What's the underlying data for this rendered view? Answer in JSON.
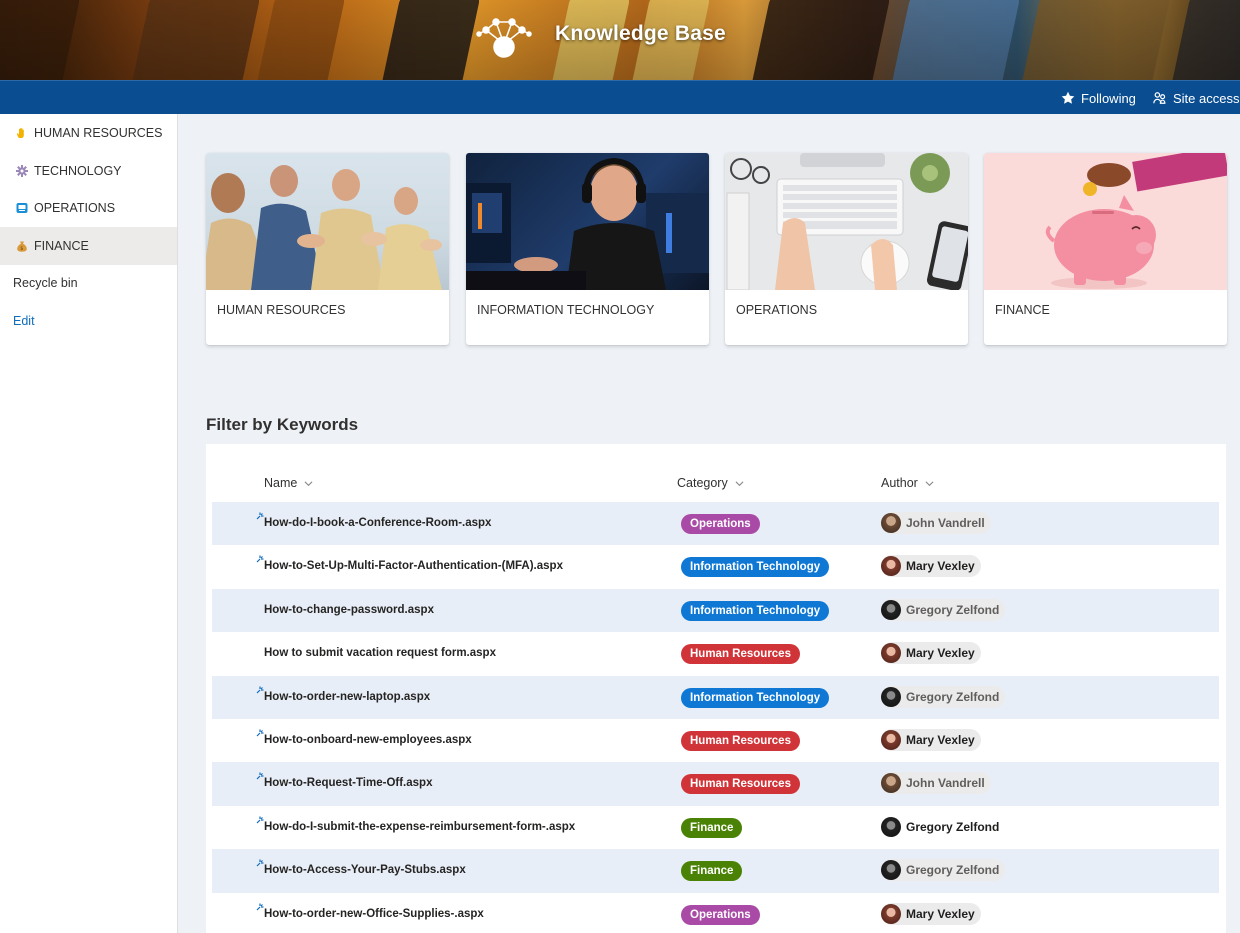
{
  "site": {
    "title": "Knowledge Base"
  },
  "command_bar": {
    "following": "Following",
    "site_access": "Site access"
  },
  "left_nav": {
    "items": [
      {
        "label": "HUMAN RESOURCES",
        "icon": "hand-icon"
      },
      {
        "label": "TECHNOLOGY",
        "icon": "gear-icon"
      },
      {
        "label": "OPERATIONS",
        "icon": "monitor-icon"
      },
      {
        "label": "FINANCE",
        "icon": "money-bag-icon"
      }
    ],
    "recycle_bin": "Recycle bin",
    "edit": "Edit"
  },
  "cards": [
    {
      "title": "HUMAN RESOURCES",
      "image": "applauding-people-image"
    },
    {
      "title": "INFORMATION TECHNOLOGY",
      "image": "person-with-headset-image"
    },
    {
      "title": "OPERATIONS",
      "image": "keyboard-desk-image"
    },
    {
      "title": "FINANCE",
      "image": "piggy-bank-image"
    }
  ],
  "filter_title": "Filter by Keywords",
  "list": {
    "columns": {
      "name": "Name",
      "category": "Category",
      "author": "Author"
    },
    "rows": [
      {
        "name": "How-do-I-book-a-Conference-Room-.aspx",
        "category": "Operations",
        "author": "John Vandrell",
        "new": true
      },
      {
        "name": "How-to-Set-Up-Multi-Factor-Authentication-(MFA).aspx",
        "category": "Information Technology",
        "author": "Mary Vexley",
        "new": true
      },
      {
        "name": "How-to-change-password.aspx",
        "category": "Information Technology",
        "author": "Gregory Zelfond",
        "new": false
      },
      {
        "name": "How to submit vacation request form.aspx",
        "category": "Human Resources",
        "author": "Mary Vexley",
        "new": false
      },
      {
        "name": "How-to-order-new-laptop.aspx",
        "category": "Information Technology",
        "author": "Gregory Zelfond",
        "new": true
      },
      {
        "name": "How-to-onboard-new-employees.aspx",
        "category": "Human Resources",
        "author": "Mary Vexley",
        "new": true
      },
      {
        "name": "How-to-Request-Time-Off.aspx",
        "category": "Human Resources",
        "author": "John Vandrell",
        "new": true
      },
      {
        "name": "How-do-I-submit-the-expense-reimbursement-form-.aspx",
        "category": "Finance",
        "author": "Gregory Zelfond",
        "new": true
      },
      {
        "name": "How-to-Access-Your-Pay-Stubs.aspx",
        "category": "Finance",
        "author": "Gregory Zelfond",
        "new": true
      },
      {
        "name": "How-to-order-new-Office-Supplies-.aspx",
        "category": "Operations",
        "author": "Mary Vexley",
        "new": true
      }
    ]
  },
  "colors": {
    "command_bar": "#0a4e91",
    "operations": "#a94ba6",
    "information_technology": "#0f78d4",
    "human_resources": "#d13438",
    "finance": "#498205"
  }
}
